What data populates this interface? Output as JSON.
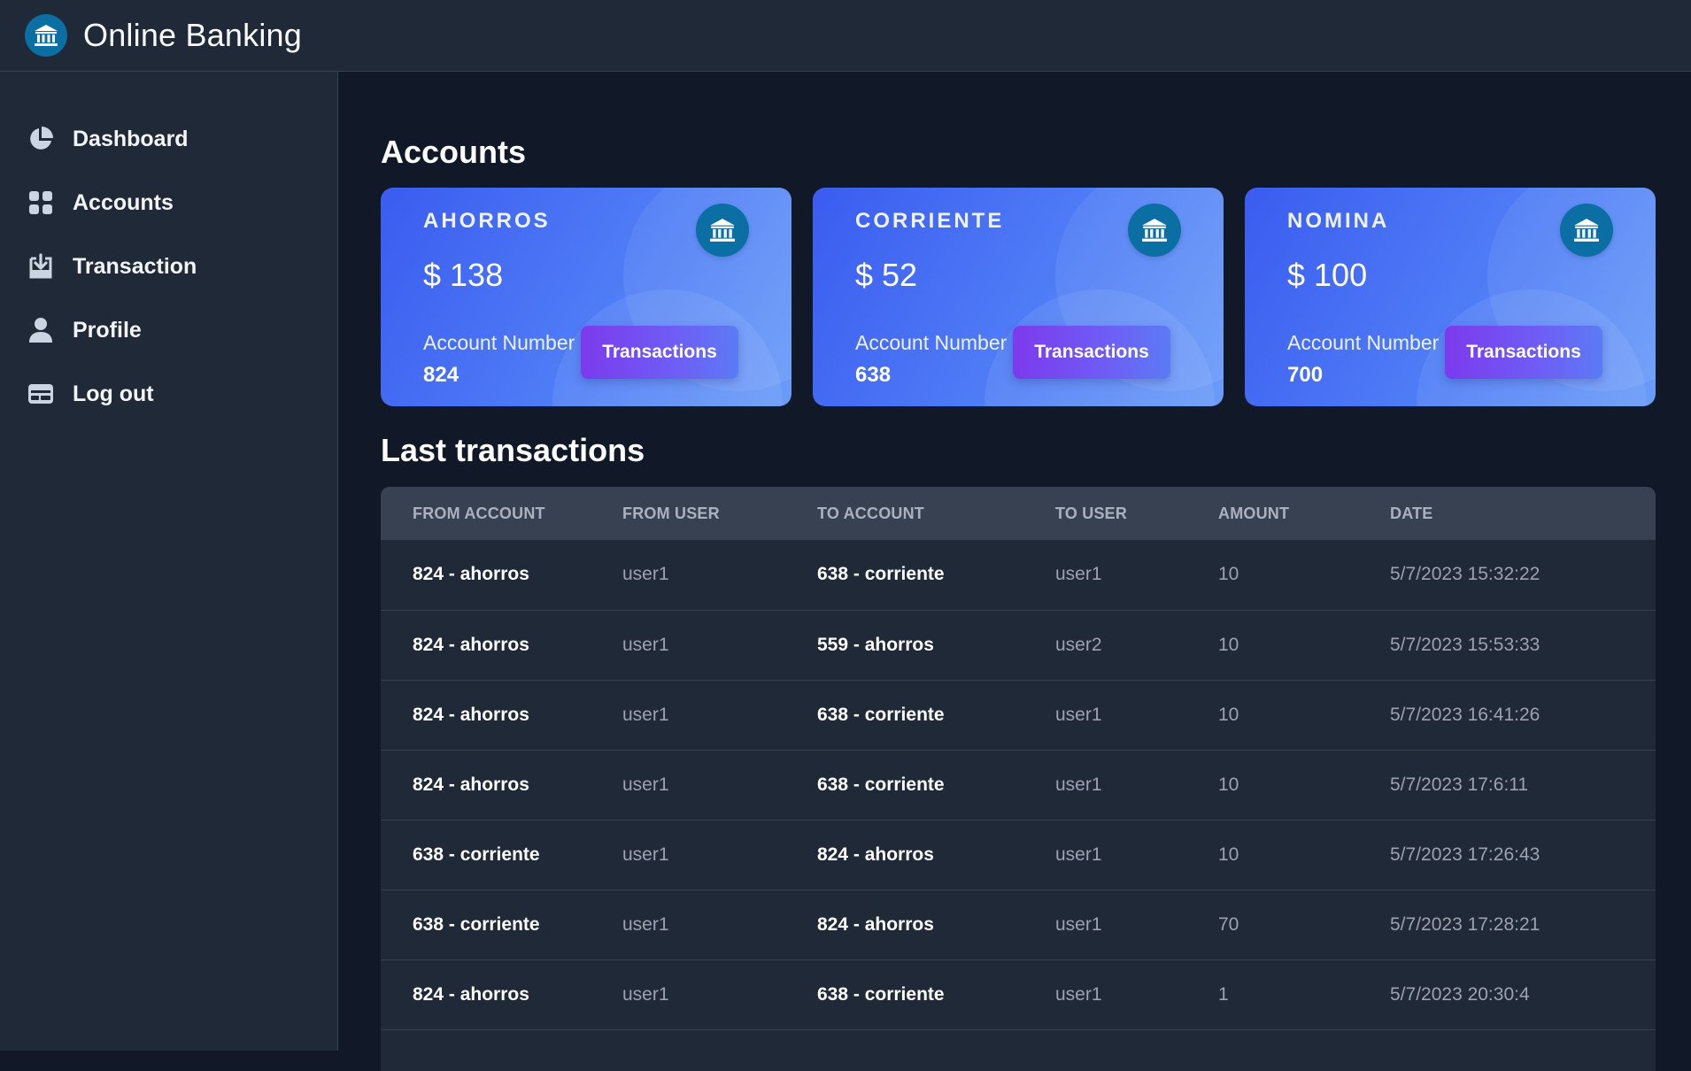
{
  "header": {
    "title": "Online Banking",
    "logo_icon": "bank-icon"
  },
  "sidebar": {
    "items": [
      {
        "label": "Dashboard",
        "icon": "pie-chart-icon"
      },
      {
        "label": "Accounts",
        "icon": "grid-icon"
      },
      {
        "label": "Transaction",
        "icon": "download-box-icon"
      },
      {
        "label": "Profile",
        "icon": "user-icon"
      },
      {
        "label": "Log out",
        "icon": "logout-card-icon"
      }
    ]
  },
  "main": {
    "accounts_title": "Accounts",
    "transactions_title": "Last transactions",
    "accounts": [
      {
        "type": "AHORROS",
        "balance": "$ 138",
        "number_label": "Account Number",
        "number": "824",
        "button": "Transactions"
      },
      {
        "type": "CORRIENTE",
        "balance": "$ 52",
        "number_label": "Account Number",
        "number": "638",
        "button": "Transactions"
      },
      {
        "type": "NOMINA",
        "balance": "$ 100",
        "number_label": "Account Number",
        "number": "700",
        "button": "Transactions"
      }
    ],
    "table": {
      "headers": [
        "FROM ACCOUNT",
        "FROM USER",
        "TO ACCOUNT",
        "TO USER",
        "AMOUNT",
        "DATE"
      ],
      "rows": [
        [
          "824 - ahorros",
          "user1",
          "638 - corriente",
          "user1",
          "10",
          "5/7/2023 15:32:22"
        ],
        [
          "824 - ahorros",
          "user1",
          "559 - ahorros",
          "user2",
          "10",
          "5/7/2023 15:53:33"
        ],
        [
          "824 - ahorros",
          "user1",
          "638 - corriente",
          "user1",
          "10",
          "5/7/2023 16:41:26"
        ],
        [
          "824 - ahorros",
          "user1",
          "638 - corriente",
          "user1",
          "10",
          "5/7/2023 17:6:11"
        ],
        [
          "638 - corriente",
          "user1",
          "824 - ahorros",
          "user1",
          "10",
          "5/7/2023 17:26:43"
        ],
        [
          "638 - corriente",
          "user1",
          "824 - ahorros",
          "user1",
          "70",
          "5/7/2023 17:28:21"
        ],
        [
          "824 - ahorros",
          "user1",
          "638 - corriente",
          "user1",
          "1",
          "5/7/2023 20:30:4"
        ]
      ]
    }
  },
  "colors": {
    "background": "#111827",
    "panel": "#1f2937",
    "card_gradient_start": "#3b5cf0",
    "card_gradient_end": "#6b9cf8",
    "button_gradient_start": "#7c3aed",
    "icon_circle": "#0b6fa3"
  }
}
